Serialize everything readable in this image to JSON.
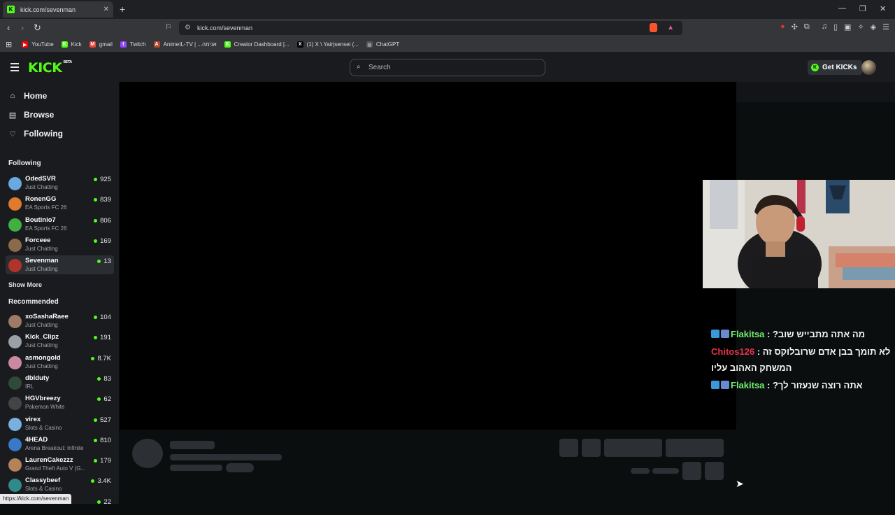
{
  "browser": {
    "tab_title": "kick.com/sevenman",
    "tab_close": "✕",
    "new_tab": "+",
    "url": "kick.com/sevenman",
    "bookmarks": [
      {
        "label": "YouTube",
        "color": "#ff0000",
        "glyph": "▶"
      },
      {
        "label": "Kick",
        "color": "#53fc18",
        "glyph": "K"
      },
      {
        "label": "gmail",
        "color": "#ea4335",
        "glyph": "M"
      },
      {
        "label": "Twitch",
        "color": "#9146ff",
        "glyph": "t"
      },
      {
        "label": "AnimeIL-TV | ...אנימה",
        "color": "#b04a2a",
        "glyph": "A"
      },
      {
        "label": "Creator Dashboard |...",
        "color": "#53fc18",
        "glyph": "K"
      },
      {
        "label": "(1) X \\ Yair|sensei (...",
        "color": "#000000",
        "glyph": "X"
      },
      {
        "label": "ChatGPT",
        "color": "#555555",
        "glyph": "◎"
      }
    ],
    "status_url": "https://kick.com/sevenman"
  },
  "header": {
    "logo": "KICK",
    "logo_beta": "BETA",
    "search_placeholder": "Search",
    "get_kicks": "Get KICKs"
  },
  "sidebar": {
    "nav": [
      {
        "label": "Home",
        "icon": "home-icon",
        "glyph": "⌂"
      },
      {
        "label": "Browse",
        "icon": "browse-icon",
        "glyph": "▤"
      },
      {
        "label": "Following",
        "icon": "heart-icon",
        "glyph": "♡"
      }
    ],
    "following_title": "Following",
    "following": [
      {
        "name": "OdedSVR",
        "category": "Just Chatting",
        "viewers": "925",
        "color": "#6aa9e0"
      },
      {
        "name": "RonenGG",
        "category": "EA Sports FC 26",
        "viewers": "839",
        "color": "#e07a2c"
      },
      {
        "name": "Boutinio7",
        "category": "EA Sports FC 26",
        "viewers": "806",
        "color": "#3fb041"
      },
      {
        "name": "Forceee",
        "category": "Just Chatting",
        "viewers": "169",
        "color": "#8a6a4a"
      },
      {
        "name": "Sevenman",
        "category": "Just Chatting",
        "viewers": "13",
        "color": "#b0342a"
      }
    ],
    "show_more": "Show More",
    "recommended_title": "Recommended",
    "recommended": [
      {
        "name": "xoSashaRaee",
        "category": "Just Chatting",
        "viewers": "104",
        "color": "#a07a66"
      },
      {
        "name": "Kick_Clipz",
        "category": "Just Chatting",
        "viewers": "191",
        "color": "#9aa0a8"
      },
      {
        "name": "asmongold",
        "category": "Just Chatting",
        "viewers": "8.7K",
        "color": "#c98aa0"
      },
      {
        "name": "dblduty",
        "category": "IRL",
        "viewers": "83",
        "color": "#2f4a3a"
      },
      {
        "name": "HGVbreezy",
        "category": "Pokemon White",
        "viewers": "62",
        "color": "#444444"
      },
      {
        "name": "virex",
        "category": "Slots & Casino",
        "viewers": "527",
        "color": "#7ab0e0"
      },
      {
        "name": "4HEAD",
        "category": "Arena Breakout: Infinite",
        "viewers": "810",
        "color": "#3a78c8"
      },
      {
        "name": "LaurenCakezzz",
        "category": "Grand Theft Auto V (G...",
        "viewers": "179",
        "color": "#b5835a"
      },
      {
        "name": "Classybeef",
        "category": "Slots & Casino",
        "viewers": "3.4K",
        "color": "#2f8a8a"
      },
      {
        "name": "",
        "category": "",
        "viewers": "22",
        "color": "#191b1f"
      }
    ]
  },
  "chat": {
    "messages": [
      {
        "user": "Flakitsa",
        "text": "מה אתה מתבייש שוב?",
        "user_color": "#6ff06f"
      },
      {
        "user": "Chitos126",
        "text": "לא תומך בבן אדם שרובלוקס זה המשחק האהוב עליו",
        "user_color": "#e8324a"
      },
      {
        "user": "Flakitsa",
        "text": "אתה רוצה שנעזור לך?",
        "user_color": "#6ff06f"
      }
    ]
  },
  "colors": {
    "accent": "#53fc18",
    "bg": "#0b0e0f",
    "panel": "#191b1f"
  }
}
